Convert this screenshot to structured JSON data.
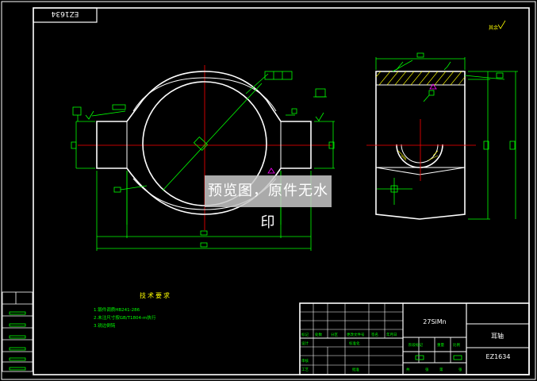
{
  "drawing": {
    "drawing_number_top": "EZ1634",
    "roughness_symbol": "其余",
    "part_name": "耳轴",
    "drawing_number": "EZ1634",
    "material": "27SiMn",
    "watermark": "预览图，原件无水印"
  },
  "tech_requirements": {
    "title": "技术要求",
    "items": [
      "1.锻件调质HB241-286",
      "2.未注尺寸按GB/T1804-m执行",
      "3.锐边倒钝"
    ]
  },
  "title_block": {
    "labels": [
      "标记",
      "处数",
      "分区",
      "更改文件号",
      "签名",
      "年月日",
      "设计",
      "标准化",
      "阶段标记",
      "重量",
      "比例",
      "审核",
      "工艺",
      "批准",
      "共",
      "张",
      "第",
      "张"
    ]
  },
  "colors": {
    "background": "#000000",
    "outline": "#ffffff",
    "dimension": "#00ff00",
    "centerline": "#ff0000",
    "hatch": "#ffff00",
    "annotation": "#ff00ff"
  }
}
